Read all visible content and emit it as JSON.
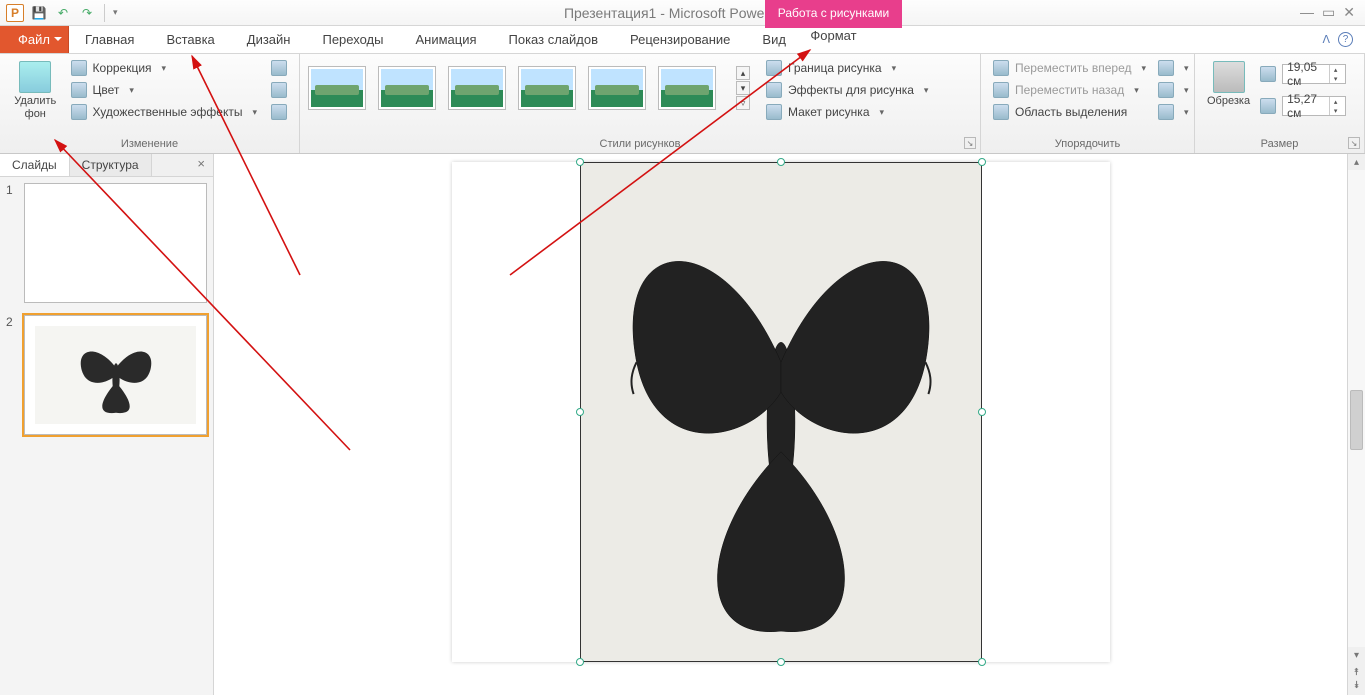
{
  "app": {
    "icon_letter": "P",
    "title": "Презентация1 - Microsoft PowerPoint",
    "context_tool_label": "Работа с рисунками"
  },
  "qat": {
    "save": "save-icon",
    "undo": "↶",
    "redo": "↷"
  },
  "tabs": {
    "file": "Файл",
    "home": "Главная",
    "insert": "Вставка",
    "design": "Дизайн",
    "transitions": "Переходы",
    "animation": "Анимация",
    "slideshow": "Показ слайдов",
    "review": "Рецензирование",
    "view": "Вид",
    "format": "Формат"
  },
  "ribbon": {
    "remove_bg": "Удалить фон",
    "corrections": "Коррекция",
    "color": "Цвет",
    "artistic": "Художественные эффекты",
    "group_change": "Изменение",
    "group_styles": "Стили рисунков",
    "border": "Граница рисунка",
    "effects": "Эффекты для рисунка",
    "layout": "Макет рисунка",
    "bring_forward": "Переместить вперед",
    "send_backward": "Переместить назад",
    "selection_pane": "Область выделения",
    "group_arrange": "Упорядочить",
    "crop": "Обрезка",
    "group_size": "Размер",
    "height_value": "19,05 см",
    "width_value": "15,27 см"
  },
  "panel": {
    "tab_slides": "Слайды",
    "tab_outline": "Структура",
    "slide1_num": "1",
    "slide2_num": "2"
  }
}
